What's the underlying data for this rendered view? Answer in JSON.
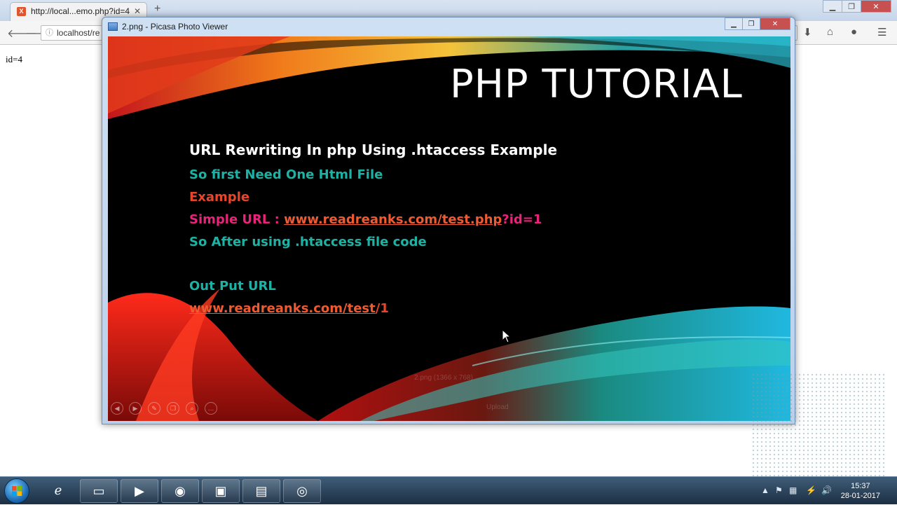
{
  "browser": {
    "tab_title": "http://local...emo.php?id=4",
    "tab_close": "✕",
    "new_tab": "+",
    "address": "localhost/re",
    "page_text": "id=4"
  },
  "picasa": {
    "window_title": "2.png - Picasa Photo Viewer",
    "image_info": "2.png (1366 x 768)",
    "upload_label": "Upload"
  },
  "slide": {
    "heading": "PHP TUTORIAL",
    "line1": "URL Rewriting In php Using .htaccess  Example",
    "line2": "So first Need One Html File",
    "line3": "Example",
    "line4_label": "Simple URL : ",
    "line4_link": "www.readreanks.com/test.php",
    "line4_suffix": "?id=1",
    "line5": "So After using  .htaccess file code",
    "line6": "Out Put URL",
    "line7_link": "www.readreanks.com/test",
    "line7_suffix": "/1"
  },
  "taskbar": {
    "time": "15:37",
    "date": "28-01-2017"
  },
  "icons": {
    "back": "back-arrow-icon",
    "forward": "forward-arrow-icon",
    "download": "download-icon",
    "home": "home-icon",
    "chat": "chat-icon",
    "menu": "hamburger-menu-icon"
  },
  "colors": {
    "teal": "#1db3a4",
    "orange": "#e8462a",
    "pink": "#e8237a"
  }
}
